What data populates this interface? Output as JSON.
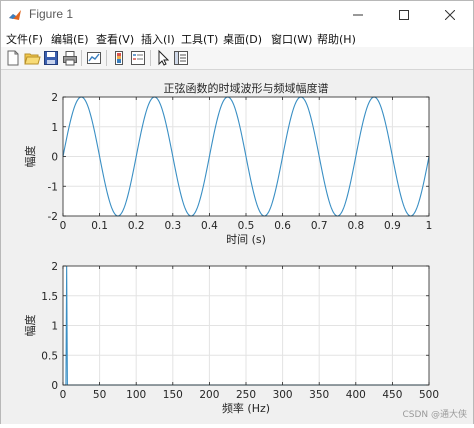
{
  "window": {
    "title": "Figure 1"
  },
  "menu": [
    {
      "label": "文件(F)"
    },
    {
      "label": "编辑(E)"
    },
    {
      "label": "查看(V)"
    },
    {
      "label": "插入(I)"
    },
    {
      "label": "工具(T)"
    },
    {
      "label": "桌面(D)"
    },
    {
      "label": "窗口(W)"
    },
    {
      "label": "帮助(H)"
    }
  ],
  "toolbar": {
    "icons": [
      "new-figure-icon",
      "open-file-icon",
      "save-icon",
      "print-icon",
      "link-plot-icon",
      "insert-colorbar-icon",
      "insert-legend-icon",
      "edit-plot-arrow-icon",
      "property-inspector-icon"
    ]
  },
  "watermark": "CSDN @通大侠",
  "chart_data": [
    {
      "type": "line",
      "title": "正弦函数的时域波形与频域幅度谱",
      "xlabel": "时间 (s)",
      "ylabel": "幅度",
      "xlim": [
        0,
        1
      ],
      "ylim": [
        -2,
        2
      ],
      "xticks": [
        0,
        0.1,
        0.2,
        0.3,
        0.4,
        0.5,
        0.6,
        0.7,
        0.8,
        0.9,
        1
      ],
      "yticks": [
        -2,
        -1,
        0,
        1,
        2
      ],
      "grid": true,
      "line_color": "#3a8fc4",
      "series": [
        {
          "function": "2*sin(2*pi*5*t)",
          "amplitude": 2,
          "frequency_hz": 5,
          "phase": 0,
          "x_range": [
            0,
            1
          ]
        }
      ]
    },
    {
      "type": "line",
      "title": "",
      "xlabel": "频率 (Hz)",
      "ylabel": "幅度",
      "xlim": [
        0,
        500
      ],
      "ylim": [
        0,
        2
      ],
      "xticks": [
        0,
        50,
        100,
        150,
        200,
        250,
        300,
        350,
        400,
        450,
        500
      ],
      "yticks": [
        0,
        0.5,
        1,
        1.5,
        2
      ],
      "grid": true,
      "line_color": "#3a8fc4",
      "series": [
        {
          "x": [
            0,
            4,
            5,
            6,
            10,
            500
          ],
          "y": [
            0,
            0,
            2,
            0,
            0,
            0
          ]
        }
      ]
    }
  ]
}
